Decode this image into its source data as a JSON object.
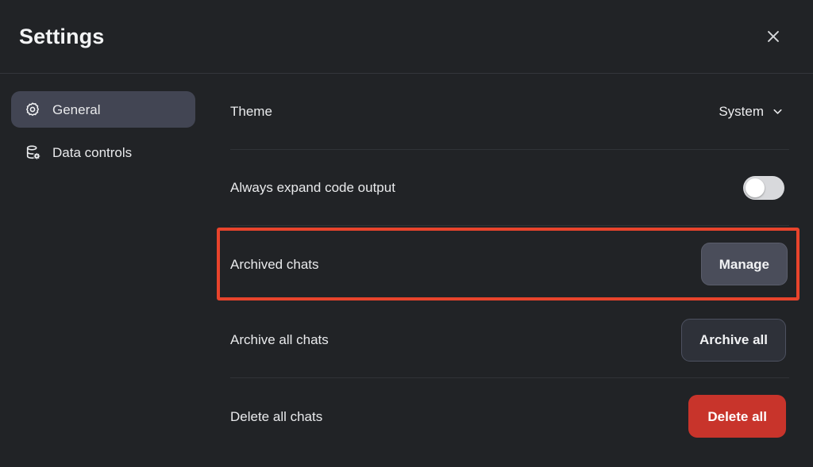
{
  "header": {
    "title": "Settings",
    "close_icon": "close-icon"
  },
  "sidebar": {
    "items": [
      {
        "label": "General",
        "icon": "gear-icon",
        "active": true
      },
      {
        "label": "Data controls",
        "icon": "database-gear-icon",
        "active": false
      }
    ]
  },
  "main": {
    "rows": [
      {
        "label": "Theme",
        "control": "select",
        "value": "System"
      },
      {
        "label": "Always expand code output",
        "control": "toggle",
        "value": "off"
      },
      {
        "label": "Archived chats",
        "control": "button",
        "value": "Manage",
        "highlighted": true
      },
      {
        "label": "Archive all chats",
        "control": "button",
        "value": "Archive all"
      },
      {
        "label": "Delete all chats",
        "control": "button",
        "value": "Delete all"
      }
    ]
  },
  "colors": {
    "background": "#212326",
    "sidebar_active": "#424553",
    "highlight_ring": "#e8442c",
    "danger_button": "#c8342b",
    "manage_button": "#4a4d5a",
    "text_primary": "#e9eaec",
    "divider": "#303337"
  }
}
